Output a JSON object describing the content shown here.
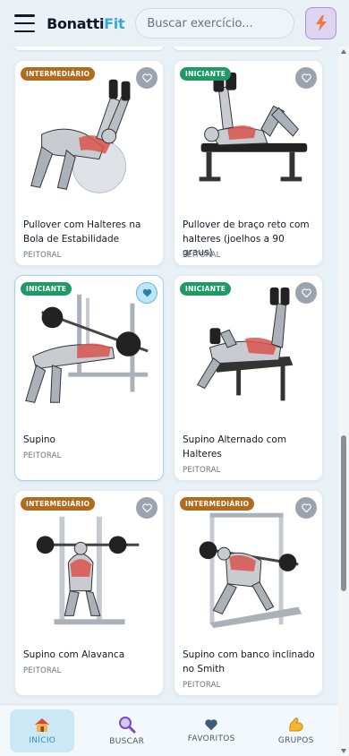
{
  "app": {
    "name_part1": "Bonatti",
    "name_part2": "Fit"
  },
  "search": {
    "placeholder": "Buscar exercício..."
  },
  "cards": [
    {
      "badge": "INTERMEDIÁRIO",
      "badge_level": "intermediate",
      "favorited": false,
      "name": "Pullover com Halteres na Bola de Estabilidade",
      "group": "PEITORAL"
    },
    {
      "badge": "INICIANTE",
      "badge_level": "beginner",
      "favorited": false,
      "name": "Pullover de braço reto com halteres (joelhos a 90 graus)",
      "group": "PEITORAL"
    },
    {
      "badge": "INICIANTE",
      "badge_level": "beginner",
      "favorited": true,
      "name": "Supino",
      "group": "PEITORAL"
    },
    {
      "badge": "INICIANTE",
      "badge_level": "beginner",
      "favorited": false,
      "name": "Supino Alternado com Halteres",
      "group": "PEITORAL"
    },
    {
      "badge": "INTERMEDIÁRIO",
      "badge_level": "intermediate",
      "favorited": false,
      "name": "Supino com Alavanca",
      "group": "PEITORAL"
    },
    {
      "badge": "INTERMEDIÁRIO",
      "badge_level": "intermediate",
      "favorited": false,
      "name": "Supino com banco inclinado no Smith",
      "group": "PEITORAL"
    }
  ],
  "nav": [
    {
      "label": "INÍCIO",
      "icon": "house-icon",
      "active": true
    },
    {
      "label": "BUSCAR",
      "icon": "magnifier-icon",
      "active": false
    },
    {
      "label": "FAVORITOS",
      "icon": "heart-icon",
      "active": false
    },
    {
      "label": "GRUPOS",
      "icon": "flexed-biceps-icon",
      "active": false
    }
  ],
  "colors": {
    "brand_dark": "#111827",
    "brand_accent": "#38a8d8",
    "badge_intermediate": "#b26a1c",
    "badge_beginner": "#1f9a67",
    "nav_active_bg": "#cce8f4"
  }
}
